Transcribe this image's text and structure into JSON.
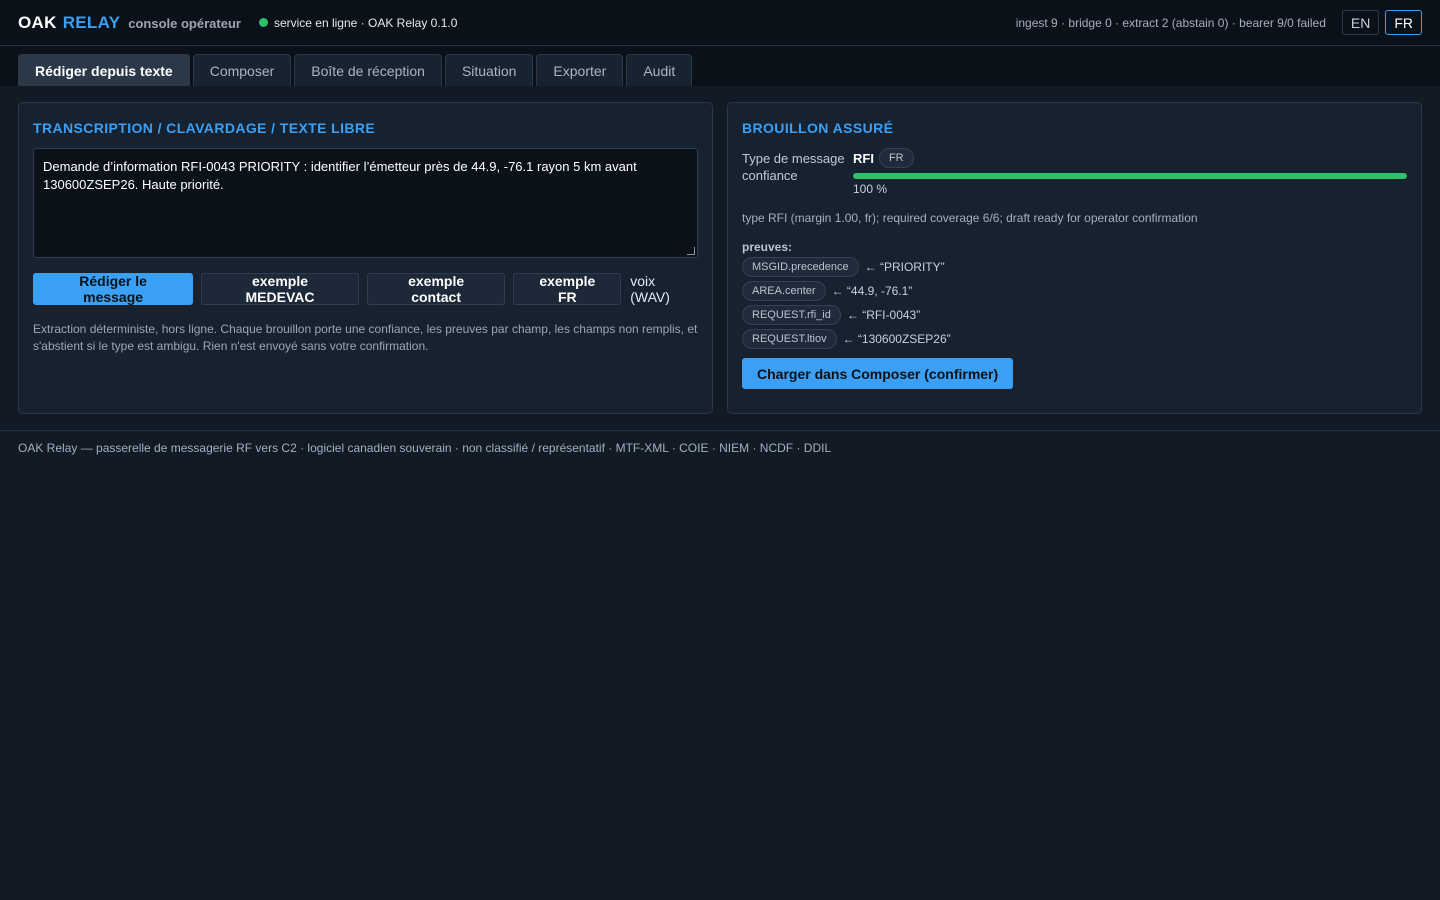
{
  "header": {
    "brand_oak": "OAK",
    "brand_relay": "RELAY",
    "brand_sub": "console opérateur",
    "status_text": "service en ligne · OAK Relay 0.1.0",
    "stats": "ingest 9 · bridge 0 · extract 2 (abstain 0) · bearer 9/0 failed",
    "lang_en": "EN",
    "lang_fr": "FR"
  },
  "tabs": [
    {
      "label": "Rédiger depuis texte",
      "active": true
    },
    {
      "label": "Composer",
      "active": false
    },
    {
      "label": "Boîte de réception",
      "active": false
    },
    {
      "label": "Situation",
      "active": false
    },
    {
      "label": "Exporter",
      "active": false
    },
    {
      "label": "Audit",
      "active": false
    }
  ],
  "left_panel": {
    "title": "TRANSCRIPTION / CLAVARDAGE / TEXTE LIBRE",
    "input_text": "Demande d’information RFI-0043 PRIORITY : identifier l’émetteur près de 44.9, -76.1 rayon 5 km avant 130600ZSEP26. Haute priorité.",
    "btn_draft": "Rédiger le message",
    "btn_medevac": "exemple MEDEVAC",
    "btn_contact": "exemple contact",
    "btn_fr": "exemple FR",
    "voice_label": "voix (WAV)",
    "help": "Extraction déterministe, hors ligne. Chaque brouillon porte une confiance, les preuves par champ, les champs non remplis, et s'abstient si le type est ambigu. Rien n'est envoyé sans votre confirmation."
  },
  "right_panel": {
    "title": "BROUILLON ASSURÉ",
    "type_label": "Type de message",
    "type_value": "RFI",
    "lang_chip": "FR",
    "conf_label": "confiance",
    "confidence": 1.0,
    "conf_text": "100 %",
    "note": "type RFI (margin 1.00, fr); required coverage 6/6; draft ready for operator confirmation",
    "proofs_title": "preuves:",
    "proofs": [
      {
        "field": "MSGID.precedence",
        "value": "← “PRIORITY”"
      },
      {
        "field": "AREA.center",
        "value": "← “44.9, -76.1”"
      },
      {
        "field": "REQUEST.rfi_id",
        "value": "← “RFI-0043”"
      },
      {
        "field": "REQUEST.ltiov",
        "value": "← “130600ZSEP26”"
      }
    ],
    "load_btn": "Charger dans Composer (confirmer)"
  },
  "footer": {
    "text": "OAK Relay — passerelle de messagerie RF vers C2 · logiciel canadien souverain · non classifié / représentatif · MTF-XML · COIE · NIEM · NCDF · DDIL"
  }
}
